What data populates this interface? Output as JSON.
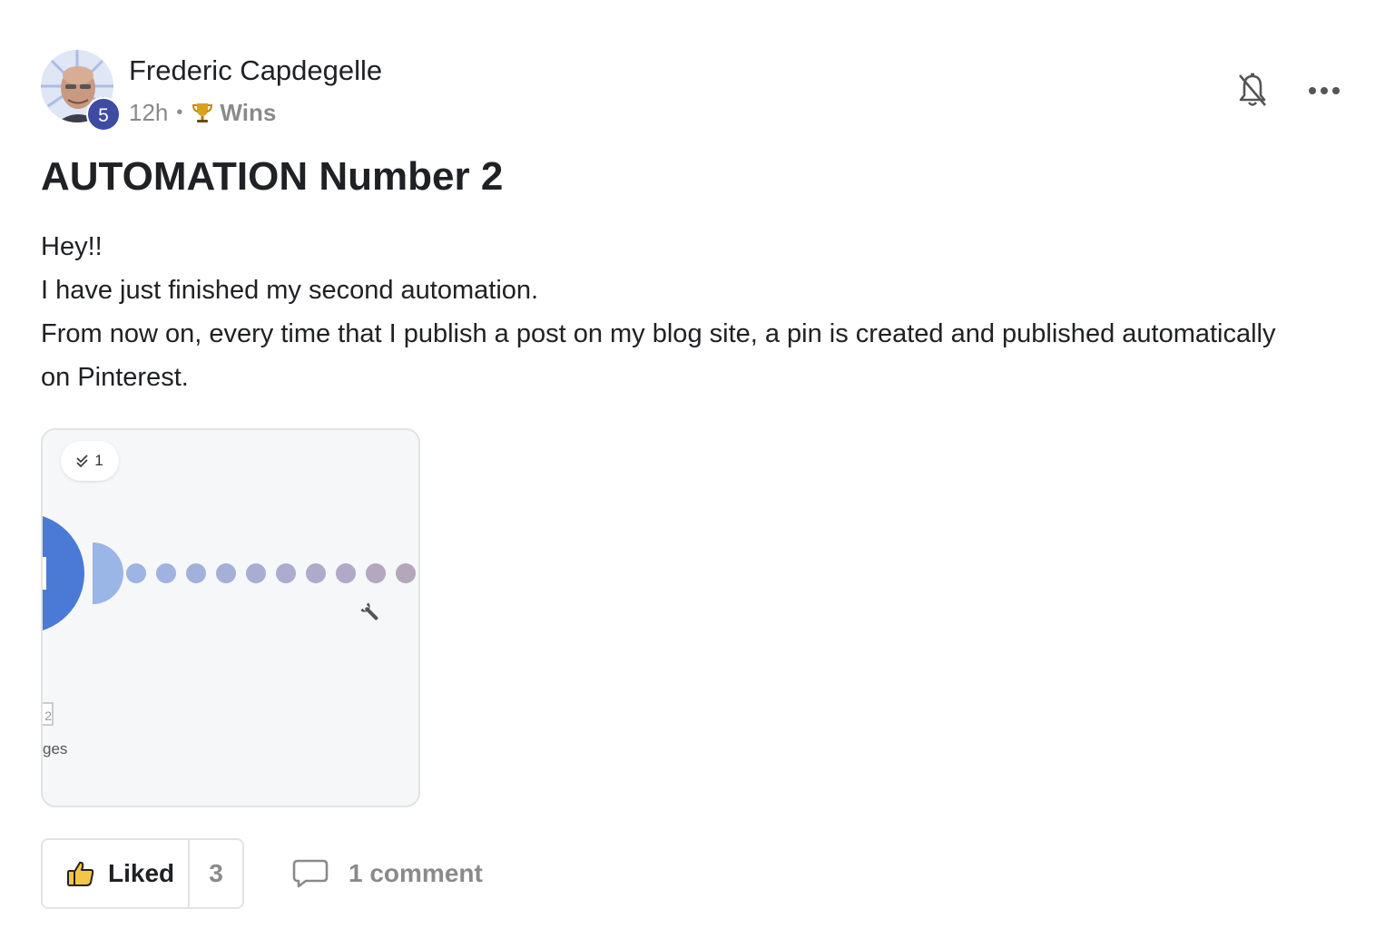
{
  "post": {
    "author": {
      "name": "Frederic Capdegelle",
      "level": "5",
      "avatar": "user-avatar-photo"
    },
    "meta": {
      "time": "12h",
      "separator": "•",
      "category_icon": "trophy-icon",
      "category": "Wins"
    },
    "actions": {
      "notifications_icon": "bell-off-icon",
      "more_icon": "more-horizontal-icon"
    },
    "title": "AUTOMATION Number 2",
    "body": [
      "Hey!!",
      "I have just finished my second automation.",
      "From now on, every time that I publish a post on my blog site, a pin is created and published automatically on Pinterest."
    ],
    "attachment": {
      "badge_count": "1",
      "partial_label": "ges",
      "partial_box": "2"
    },
    "footer": {
      "like_label": "Liked",
      "like_count": "3",
      "comment_label": "1 comment"
    }
  },
  "colors": {
    "level_badge": "#3d4ba3",
    "muted_text": "#8a8a8a",
    "primary_text": "#202124",
    "module_blue": "#4a7ad6"
  }
}
